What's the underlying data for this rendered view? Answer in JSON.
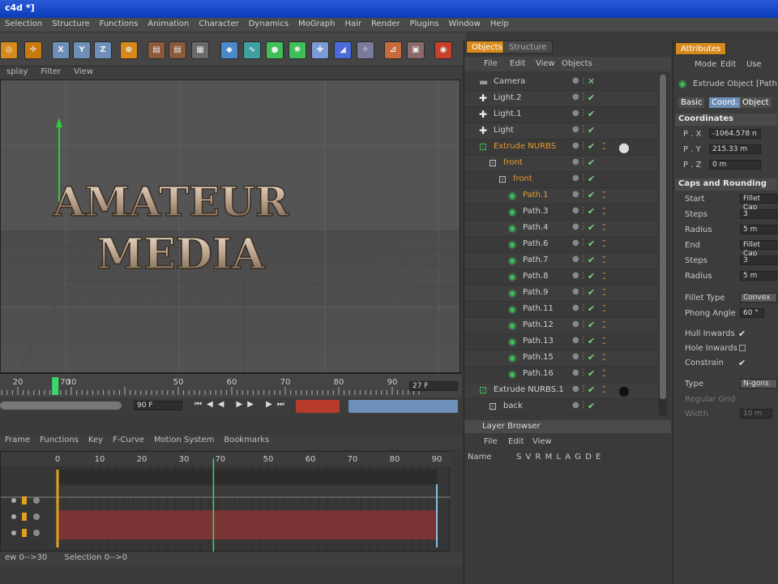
{
  "title": "c4d *]",
  "menu": [
    "Selection",
    "Structure",
    "Functions",
    "Animation",
    "Character",
    "Dynamics",
    "MoGraph",
    "Hair",
    "Render",
    "Plugins",
    "Window",
    "Help"
  ],
  "toolbar": {
    "x": "X",
    "y": "Y",
    "z": "Z"
  },
  "viewport": {
    "menu": [
      "splay",
      "Filter",
      "View"
    ],
    "text_line1": "AMATEUR",
    "text_line2": "MEDIA"
  },
  "timeline": {
    "ticks": [
      "20",
      "30",
      "50",
      "60",
      "70",
      "80",
      "90"
    ],
    "current": "27 F",
    "frame_box": "90 F",
    "marker_value": "70"
  },
  "fcurve": {
    "menu": [
      "Frame",
      "Functions",
      "Key",
      "F-Curve",
      "Motion System",
      "Bookmarks"
    ],
    "ticks": [
      "0",
      "10",
      "20",
      "30",
      "50",
      "60",
      "70",
      "80",
      "90"
    ],
    "marker_value": "70"
  },
  "status": {
    "left": "ew 0-->30",
    "right": "Selection 0-->0"
  },
  "objects": {
    "tabs": [
      "Objects",
      "Structure"
    ],
    "menu": [
      "File",
      "Edit",
      "View",
      "Objects"
    ],
    "rows": [
      {
        "name": "Camera",
        "indent": 0,
        "kind": "camera"
      },
      {
        "name": "Light.2",
        "indent": 0,
        "kind": "light"
      },
      {
        "name": "Light.1",
        "indent": 0,
        "kind": "light"
      },
      {
        "name": "Light",
        "indent": 0,
        "kind": "light"
      },
      {
        "name": "Extrude NURBS",
        "indent": 0,
        "kind": "nurbs",
        "orange": true
      },
      {
        "name": "front",
        "indent": 1,
        "kind": "null",
        "orange": true
      },
      {
        "name": "front",
        "indent": 2,
        "kind": "null",
        "orange": true
      },
      {
        "name": "Path.1",
        "indent": 3,
        "kind": "path",
        "orange": true
      },
      {
        "name": "Path.3",
        "indent": 3,
        "kind": "path"
      },
      {
        "name": "Path.4",
        "indent": 3,
        "kind": "path"
      },
      {
        "name": "Path.6",
        "indent": 3,
        "kind": "path"
      },
      {
        "name": "Path.7",
        "indent": 3,
        "kind": "path"
      },
      {
        "name": "Path.8",
        "indent": 3,
        "kind": "path"
      },
      {
        "name": "Path.9",
        "indent": 3,
        "kind": "path"
      },
      {
        "name": "Path.11",
        "indent": 3,
        "kind": "path"
      },
      {
        "name": "Path.12",
        "indent": 3,
        "kind": "path"
      },
      {
        "name": "Path.13",
        "indent": 3,
        "kind": "path"
      },
      {
        "name": "Path.15",
        "indent": 3,
        "kind": "path"
      },
      {
        "name": "Path.16",
        "indent": 3,
        "kind": "path"
      },
      {
        "name": "Extrude NURBS.1",
        "indent": 0,
        "kind": "nurbs"
      },
      {
        "name": "back",
        "indent": 1,
        "kind": "null"
      }
    ]
  },
  "layers": {
    "title": "Layer Browser",
    "menu": [
      "File",
      "Edit",
      "View"
    ],
    "name_col": "Name",
    "cols": "S V R M L A G D E"
  },
  "attributes": {
    "tab": "Attributes",
    "menu": [
      "Mode",
      "Edit",
      "Use"
    ],
    "object": "Extrude Object [Path",
    "subtabs": [
      "Basic",
      "Coord.",
      "Object"
    ],
    "coords_header": "Coordinates",
    "coords": [
      {
        "label": "P . X",
        "value": "-1064.578 n"
      },
      {
        "label": "P . Y",
        "value": "215.33 m"
      },
      {
        "label": "P . Z",
        "value": "0 m"
      }
    ],
    "caps_header": "Caps and Rounding",
    "caps": [
      {
        "label": "Start",
        "value": "Fillet Cap"
      },
      {
        "label": "Steps",
        "value": "3"
      },
      {
        "label": "Radius",
        "value": "5 m"
      },
      {
        "label": "End",
        "value": "Fillet Cap"
      },
      {
        "label": "Steps",
        "value": "3"
      },
      {
        "label": "Radius",
        "value": "5 m"
      }
    ],
    "fillet_type_label": "Fillet Type",
    "fillet_type": "Convex",
    "phong_label": "Phong Angle",
    "phong": "60 °",
    "checks": [
      {
        "label": "Hull Inwards",
        "checked": true
      },
      {
        "label": "Hole Inwards",
        "checked": false
      },
      {
        "label": "Constrain",
        "checked": true
      }
    ],
    "type_label": "Type",
    "type": "N-gons",
    "grid_label": "Regular Grid",
    "width_label": "Width",
    "width": "10 m"
  },
  "colors": {
    "accent": "#d68a1e",
    "path_icon": "#3fbf5a",
    "check": "#7fd77f"
  }
}
